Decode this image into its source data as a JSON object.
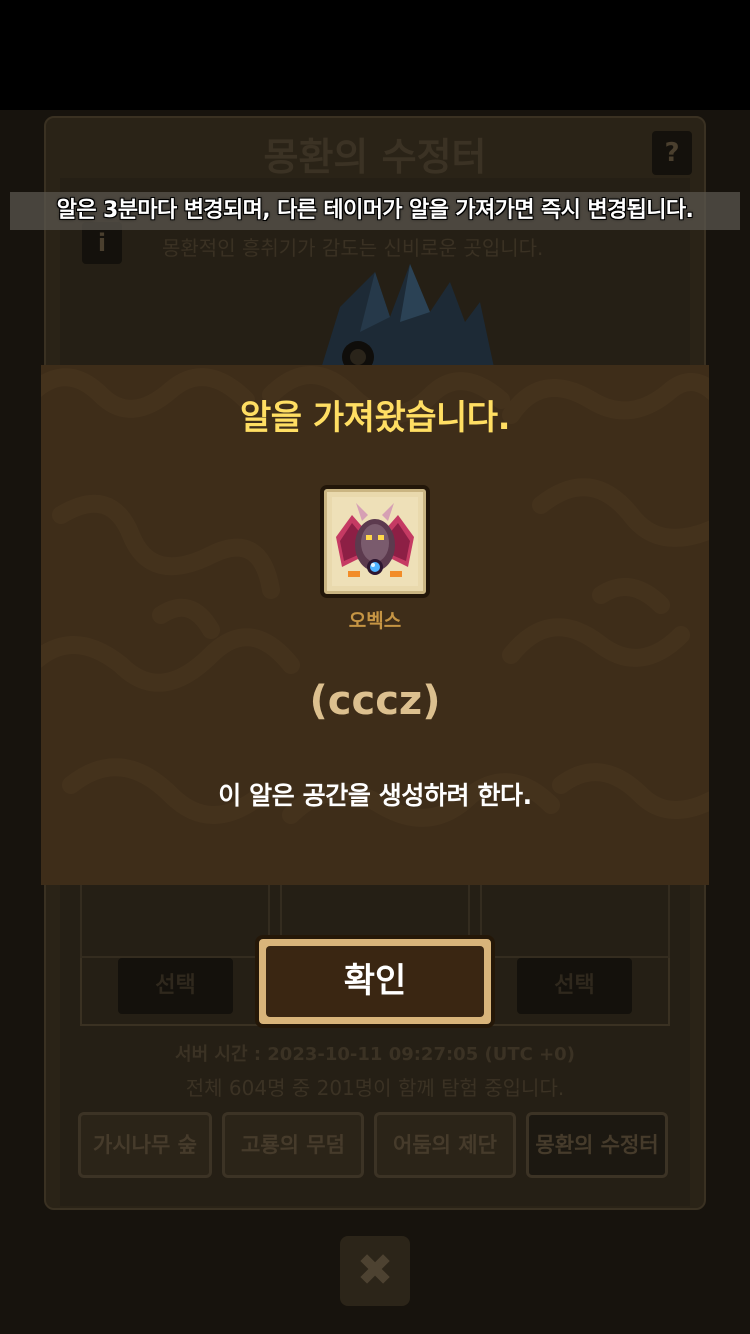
{
  "background": {
    "title": "몽환의 수정터",
    "help_label": "?",
    "info_label": "i",
    "description": "몽환적인 흥취기가 감도는 신비로운 곳입니다.",
    "select_left": "선택",
    "select_right": "선택",
    "server_time": "서버 시간 : 2023-10-11 09:27:05 (UTC +0)",
    "players_info": "전체 604명 중 201명이 함께 탐험 중입니다.",
    "tabs": [
      {
        "label": "가시나무 숲"
      },
      {
        "label": "고룡의 무덤"
      },
      {
        "label": "어둠의 제단"
      },
      {
        "label": "몽환의 수정터"
      }
    ],
    "close_label": "✖"
  },
  "notice": "알은 3분마다 변경되며, 다른 테이머가 알을 가져가면 즉시 변경됩니다.",
  "modal": {
    "title": "알을 가져왔습니다.",
    "egg_name": "오벡스",
    "owner": "(cccz)",
    "description": "이 알은 공간을 생성하려 한다.",
    "confirm_label": "확인"
  },
  "colors": {
    "modal_bg": "#3e2d19",
    "title_gold": "#ffde63",
    "egg_name": "#c69544",
    "owner_text": "#dcc08f"
  },
  "icons": {
    "help": "question-mark-icon",
    "info": "info-icon",
    "close": "close-icon",
    "egg": "egg-icon"
  }
}
